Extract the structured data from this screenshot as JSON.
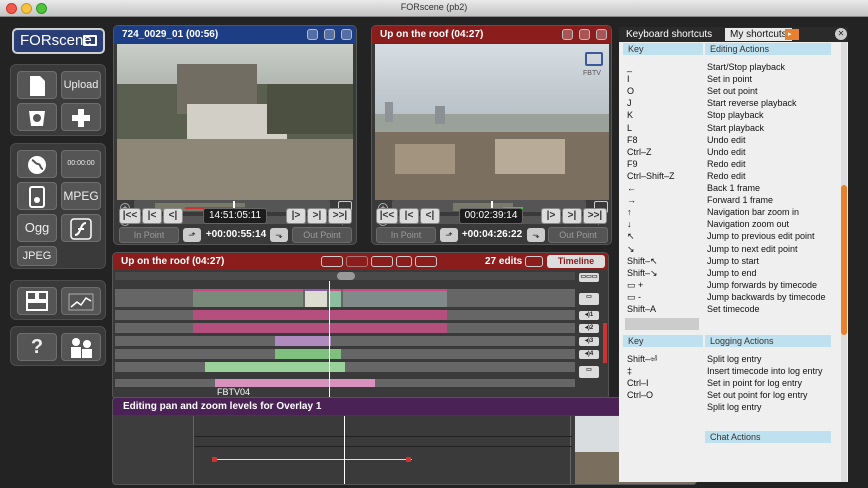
{
  "window": {
    "title": "FORscene (pb2)"
  },
  "logo": {
    "text": "FORscene"
  },
  "toolbar": {
    "upload_label": "Upload",
    "timecode_label": "00:00:00",
    "mpeg_label": "MPEG",
    "ogg_label": "Ogg",
    "jpeg_label": "JPEG",
    "help_label": "?"
  },
  "viewer_left": {
    "title": "724_0029_01 (00:56)",
    "timecode": "14:51:05:11",
    "in_label": "In Point",
    "out_label": "Out Point",
    "duration": "+00:00:55:14",
    "nav_labels": [
      "|<<",
      "|<",
      "<|",
      "|>",
      ">|",
      ">>|"
    ]
  },
  "viewer_right": {
    "title": "Up on the roof (04:27)",
    "timecode": "00:02:39:14",
    "in_label": "In Point",
    "out_label": "Out Point",
    "duration": "+00:04:26:22",
    "watermark": "FBTV",
    "nav_labels": [
      "|<<",
      "|<",
      "<|",
      "|>",
      ">|",
      ">>|"
    ]
  },
  "timeline": {
    "title": "Up on the roof (04:27)",
    "edits": "27 edits",
    "timeline_label": "Timeline",
    "clip_label": "FBTV04",
    "audio_labels": [
      "1",
      "2",
      "3",
      "4"
    ]
  },
  "overlay": {
    "title": "Editing pan and zoom levels for Overlay 1"
  },
  "shortcuts": {
    "tab_keyboard": "Keyboard shortcuts",
    "tab_mine": "My shortcuts",
    "key_header": "Key",
    "editing_header": "Editing Actions",
    "editing_rows": [
      {
        "key": "_",
        "action": "Start/Stop playback"
      },
      {
        "key": "I",
        "action": "Set in point"
      },
      {
        "key": "O",
        "action": "Set out point"
      },
      {
        "key": "J",
        "action": "Start reverse playback"
      },
      {
        "key": "K",
        "action": "Stop playback"
      },
      {
        "key": "L",
        "action": "Start playback"
      },
      {
        "key": "F8",
        "action": "Undo edit"
      },
      {
        "key": "Ctrl–Z",
        "action": "Undo edit"
      },
      {
        "key": "F9",
        "action": "Redo edit"
      },
      {
        "key": "Ctrl–Shift–Z",
        "action": "Redo edit"
      },
      {
        "key": "←",
        "action": "Back 1 frame"
      },
      {
        "key": "→",
        "action": "Forward 1 frame"
      },
      {
        "key": "↑",
        "action": "Navigation bar zoom in"
      },
      {
        "key": "↓",
        "action": "Navigation zoom out"
      },
      {
        "key": "↖",
        "action": "Jump to previous edit point"
      },
      {
        "key": "↘",
        "action": "Jump to next edit point"
      },
      {
        "key": "Shift–↖",
        "action": "Jump to start"
      },
      {
        "key": "Shift–↘",
        "action": "Jump to end"
      },
      {
        "key": "▭ +",
        "action": "Jump forwards by timecode"
      },
      {
        "key": "▭ -",
        "action": "Jump backwards by timecode"
      },
      {
        "key": "Shift–A",
        "action": "Set timecode"
      }
    ],
    "logging_header": "Logging Actions",
    "logging_rows": [
      {
        "key": "Shift–⏎",
        "action": "Split log entry"
      },
      {
        "key": "‡",
        "action": "Insert timecode into log entry"
      },
      {
        "key": "Ctrl–I",
        "action": "Set in point for log entry"
      },
      {
        "key": "Ctrl–O",
        "action": "Set out point for log entry"
      },
      {
        "key": "",
        "action": "Split log entry"
      }
    ],
    "chat_header": "Chat Actions"
  }
}
